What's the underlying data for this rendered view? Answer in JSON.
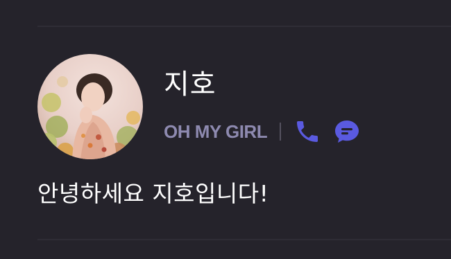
{
  "profile": {
    "name": "지호",
    "group": "OH MY GIRL",
    "status_message": "안녕하세요 지호입니다!"
  },
  "icons": {
    "call": "phone-icon",
    "chat": "chat-bubble-icon"
  },
  "colors": {
    "background": "#25232b",
    "accent": "#5a5ae0",
    "group_text": "#8e8ab0"
  }
}
